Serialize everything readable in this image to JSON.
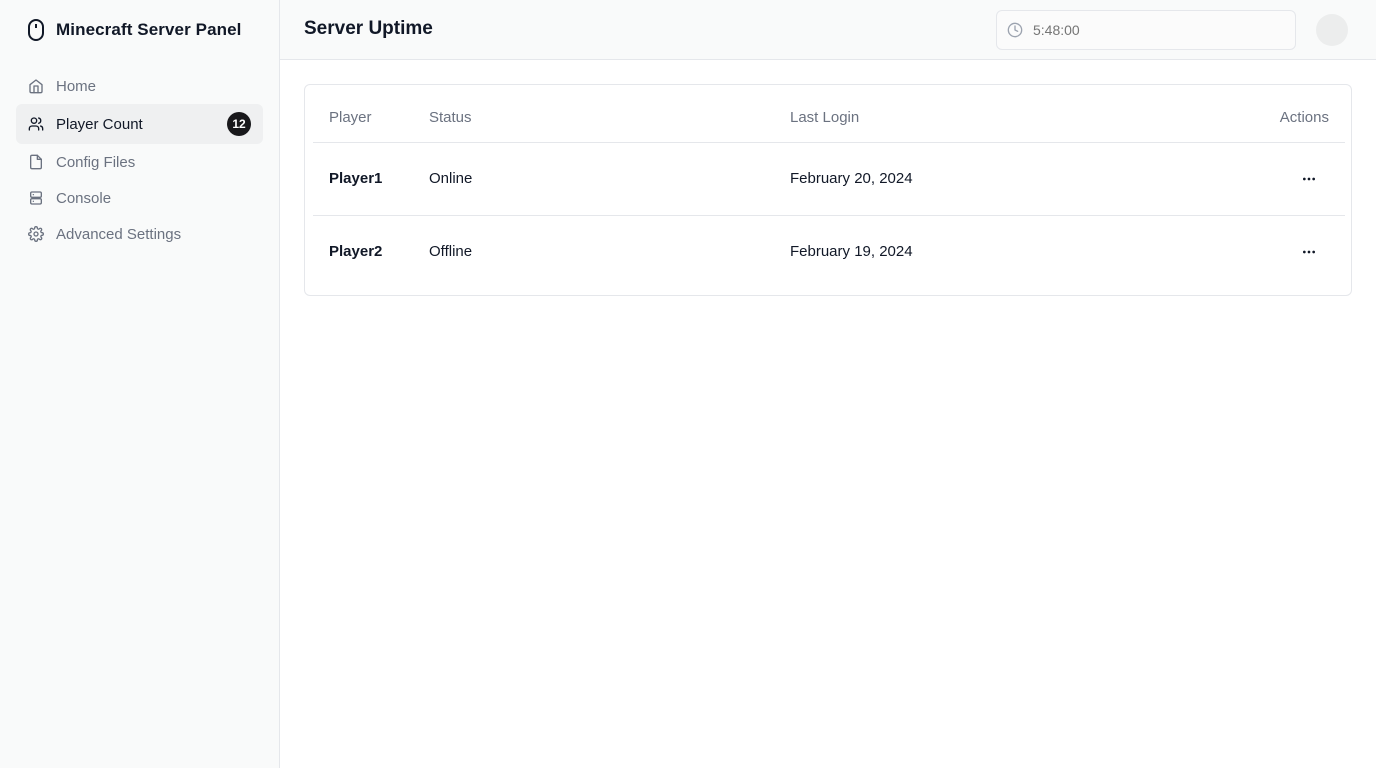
{
  "sidebar": {
    "brand_title": "Minecraft Server Panel",
    "brand_icon": "mouse-icon",
    "items": [
      {
        "label": "Home",
        "icon": "home-icon"
      },
      {
        "label": "Player Count",
        "icon": "users-icon",
        "badge": "12",
        "active": true
      },
      {
        "label": "Config Files",
        "icon": "file-icon"
      },
      {
        "label": "Console",
        "icon": "server-icon"
      },
      {
        "label": "Advanced Settings",
        "icon": "gear-icon"
      }
    ]
  },
  "header": {
    "title": "Server Uptime",
    "uptime_placeholder": "5:48:00",
    "uptime_icon": "clock-icon"
  },
  "table": {
    "columns": [
      "Player",
      "Status",
      "Last Login",
      "Actions"
    ],
    "rows": [
      {
        "player": "Player1",
        "status": "Online",
        "last_login": "February 20, 2024"
      },
      {
        "player": "Player2",
        "status": "Offline",
        "last_login": "February 19, 2024"
      }
    ]
  },
  "colors": {
    "accent_dark": "#18181b",
    "sidebar_bg": "#f9fafa",
    "muted_text": "#6b7280"
  }
}
